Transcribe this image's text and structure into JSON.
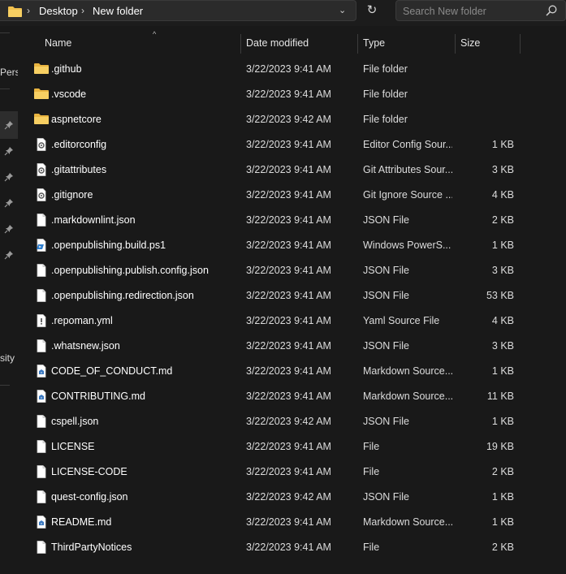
{
  "address": {
    "crumbs": [
      "Desktop",
      "New folder"
    ],
    "separator": "›",
    "dropdown": "⌄",
    "refresh": "↻"
  },
  "search": {
    "placeholder": "Search New folder"
  },
  "left_pane": {
    "label_top": "Pers",
    "label_bottom": "sity"
  },
  "columns": {
    "name": "Name",
    "date": "Date modified",
    "type": "Type",
    "size": "Size",
    "sort_glyph": "^"
  },
  "files": [
    {
      "name": ".github",
      "date": "3/22/2023 9:41 AM",
      "type": "File folder",
      "size": "",
      "icon": "folder"
    },
    {
      "name": ".vscode",
      "date": "3/22/2023 9:41 AM",
      "type": "File folder",
      "size": "",
      "icon": "folder"
    },
    {
      "name": "aspnetcore",
      "date": "3/22/2023 9:42 AM",
      "type": "File folder",
      "size": "",
      "icon": "folder"
    },
    {
      "name": ".editorconfig",
      "date": "3/22/2023 9:41 AM",
      "type": "Editor Config Sour...",
      "size": "1 KB",
      "icon": "config"
    },
    {
      "name": ".gitattributes",
      "date": "3/22/2023 9:41 AM",
      "type": "Git Attributes Sour...",
      "size": "3 KB",
      "icon": "config"
    },
    {
      "name": ".gitignore",
      "date": "3/22/2023 9:41 AM",
      "type": "Git Ignore Source ...",
      "size": "4 KB",
      "icon": "config"
    },
    {
      "name": ".markdownlint.json",
      "date": "3/22/2023 9:41 AM",
      "type": "JSON File",
      "size": "2 KB",
      "icon": "file"
    },
    {
      "name": ".openpublishing.build.ps1",
      "date": "3/22/2023 9:41 AM",
      "type": "Windows PowerS...",
      "size": "1 KB",
      "icon": "powershell"
    },
    {
      "name": ".openpublishing.publish.config.json",
      "date": "3/22/2023 9:41 AM",
      "type": "JSON File",
      "size": "3 KB",
      "icon": "file"
    },
    {
      "name": ".openpublishing.redirection.json",
      "date": "3/22/2023 9:41 AM",
      "type": "JSON File",
      "size": "53 KB",
      "icon": "file"
    },
    {
      "name": ".repoman.yml",
      "date": "3/22/2023 9:41 AM",
      "type": "Yaml Source File",
      "size": "4 KB",
      "icon": "yaml"
    },
    {
      "name": ".whatsnew.json",
      "date": "3/22/2023 9:41 AM",
      "type": "JSON File",
      "size": "3 KB",
      "icon": "file"
    },
    {
      "name": "CODE_OF_CONDUCT.md",
      "date": "3/22/2023 9:41 AM",
      "type": "Markdown Source...",
      "size": "1 KB",
      "icon": "markdown"
    },
    {
      "name": "CONTRIBUTING.md",
      "date": "3/22/2023 9:41 AM",
      "type": "Markdown Source...",
      "size": "11 KB",
      "icon": "markdown"
    },
    {
      "name": "cspell.json",
      "date": "3/22/2023 9:42 AM",
      "type": "JSON File",
      "size": "1 KB",
      "icon": "file"
    },
    {
      "name": "LICENSE",
      "date": "3/22/2023 9:41 AM",
      "type": "File",
      "size": "19 KB",
      "icon": "file"
    },
    {
      "name": "LICENSE-CODE",
      "date": "3/22/2023 9:41 AM",
      "type": "File",
      "size": "2 KB",
      "icon": "file"
    },
    {
      "name": "quest-config.json",
      "date": "3/22/2023 9:42 AM",
      "type": "JSON File",
      "size": "1 KB",
      "icon": "file"
    },
    {
      "name": "README.md",
      "date": "3/22/2023 9:41 AM",
      "type": "Markdown Source...",
      "size": "1 KB",
      "icon": "markdown"
    },
    {
      "name": "ThirdPartyNotices",
      "date": "3/22/2023 9:41 AM",
      "type": "File",
      "size": "2 KB",
      "icon": "file"
    }
  ],
  "colors": {
    "background": "#191919",
    "folder": "#f2c14e",
    "accent": "#4a9fe0"
  }
}
